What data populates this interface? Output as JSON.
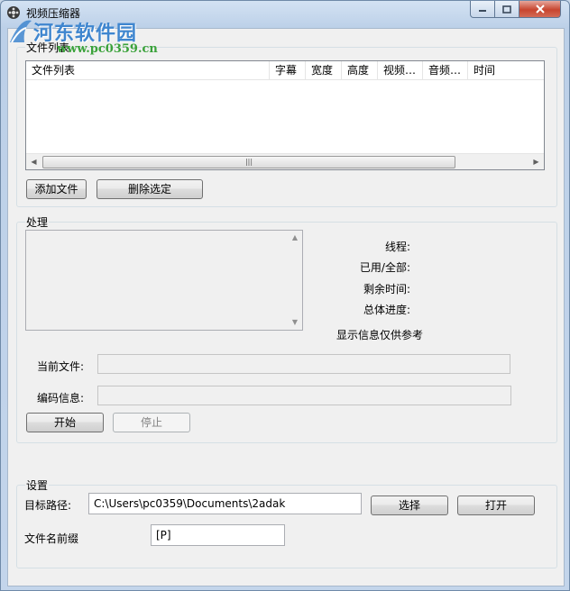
{
  "window": {
    "title": "视频压缩器",
    "watermark": "河东软件园",
    "watermark_url": "www.pc0359.cn"
  },
  "file_group": {
    "label": "文件列表",
    "columns": [
      "文件列表",
      "字幕",
      "宽度",
      "高度",
      "视频…",
      "音频…",
      "时间"
    ],
    "add_button": "添加文件",
    "delete_button": "删除选定"
  },
  "process_group": {
    "label": "处理",
    "stats": {
      "threads": "线程:",
      "used_total": "已用/全部:",
      "remaining": "剩余时间:",
      "overall": "总体进度:"
    },
    "note": "显示信息仅供参考",
    "current_file_label": "当前文件:",
    "codec_label": "编码信息:",
    "start_button": "开始",
    "stop_button": "停止"
  },
  "settings_group": {
    "label": "设置",
    "target_path_label": "目标路径:",
    "target_path_value": "C:\\Users\\pc0359\\Documents\\2adak",
    "browse_button": "选择",
    "open_button": "打开",
    "prefix_label": "文件名前缀",
    "prefix_value": "[P]"
  },
  "colors": {
    "watermark_blue": "#3f86cf",
    "watermark_green": "#3aa23a",
    "close_red": "#c8452f"
  }
}
